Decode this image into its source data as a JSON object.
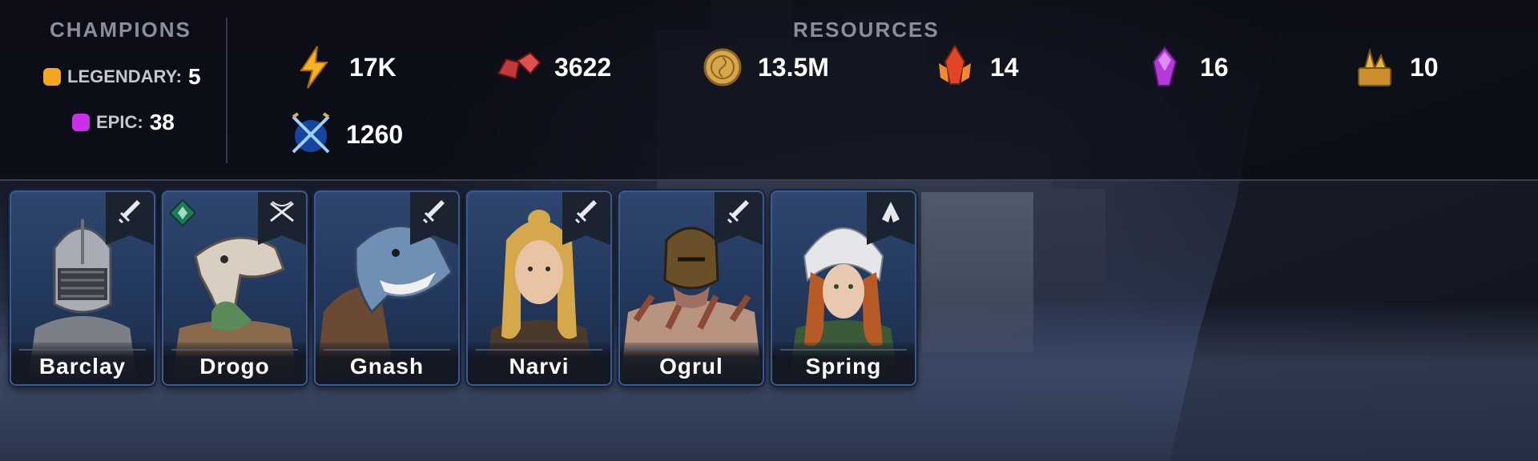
{
  "champions": {
    "title": "CHAMPIONS",
    "legendary": {
      "label": "LEGENDARY:",
      "count": "5",
      "color": "#f5a623"
    },
    "epic": {
      "label": "EPIC:",
      "count": "38",
      "color": "#c930e8"
    }
  },
  "resources": {
    "title": "RESOURCES",
    "items": [
      {
        "icon": "energy-icon",
        "value": "17K"
      },
      {
        "icon": "ruby-gems-icon",
        "value": "3622"
      },
      {
        "icon": "silver-coin-icon",
        "value": "13.5M"
      },
      {
        "icon": "red-crystal-icon",
        "value": "14"
      },
      {
        "icon": "purple-crystal-icon",
        "value": "16"
      },
      {
        "icon": "gold-shard-icon",
        "value": "10"
      },
      {
        "icon": "arena-token-icon",
        "value": "1260"
      }
    ]
  },
  "roster": [
    {
      "name": "Barclay",
      "role_icon": "sword-icon"
    },
    {
      "name": "Drogo",
      "role_icon": "crossbow-icon",
      "affinity_icon": "force-affinity-icon"
    },
    {
      "name": "Gnash",
      "role_icon": "sword-icon"
    },
    {
      "name": "Narvi",
      "role_icon": "sword-icon"
    },
    {
      "name": "Ogrul",
      "role_icon": "sword-icon"
    },
    {
      "name": "Spring",
      "role_icon": "praying-hands-icon"
    }
  ]
}
